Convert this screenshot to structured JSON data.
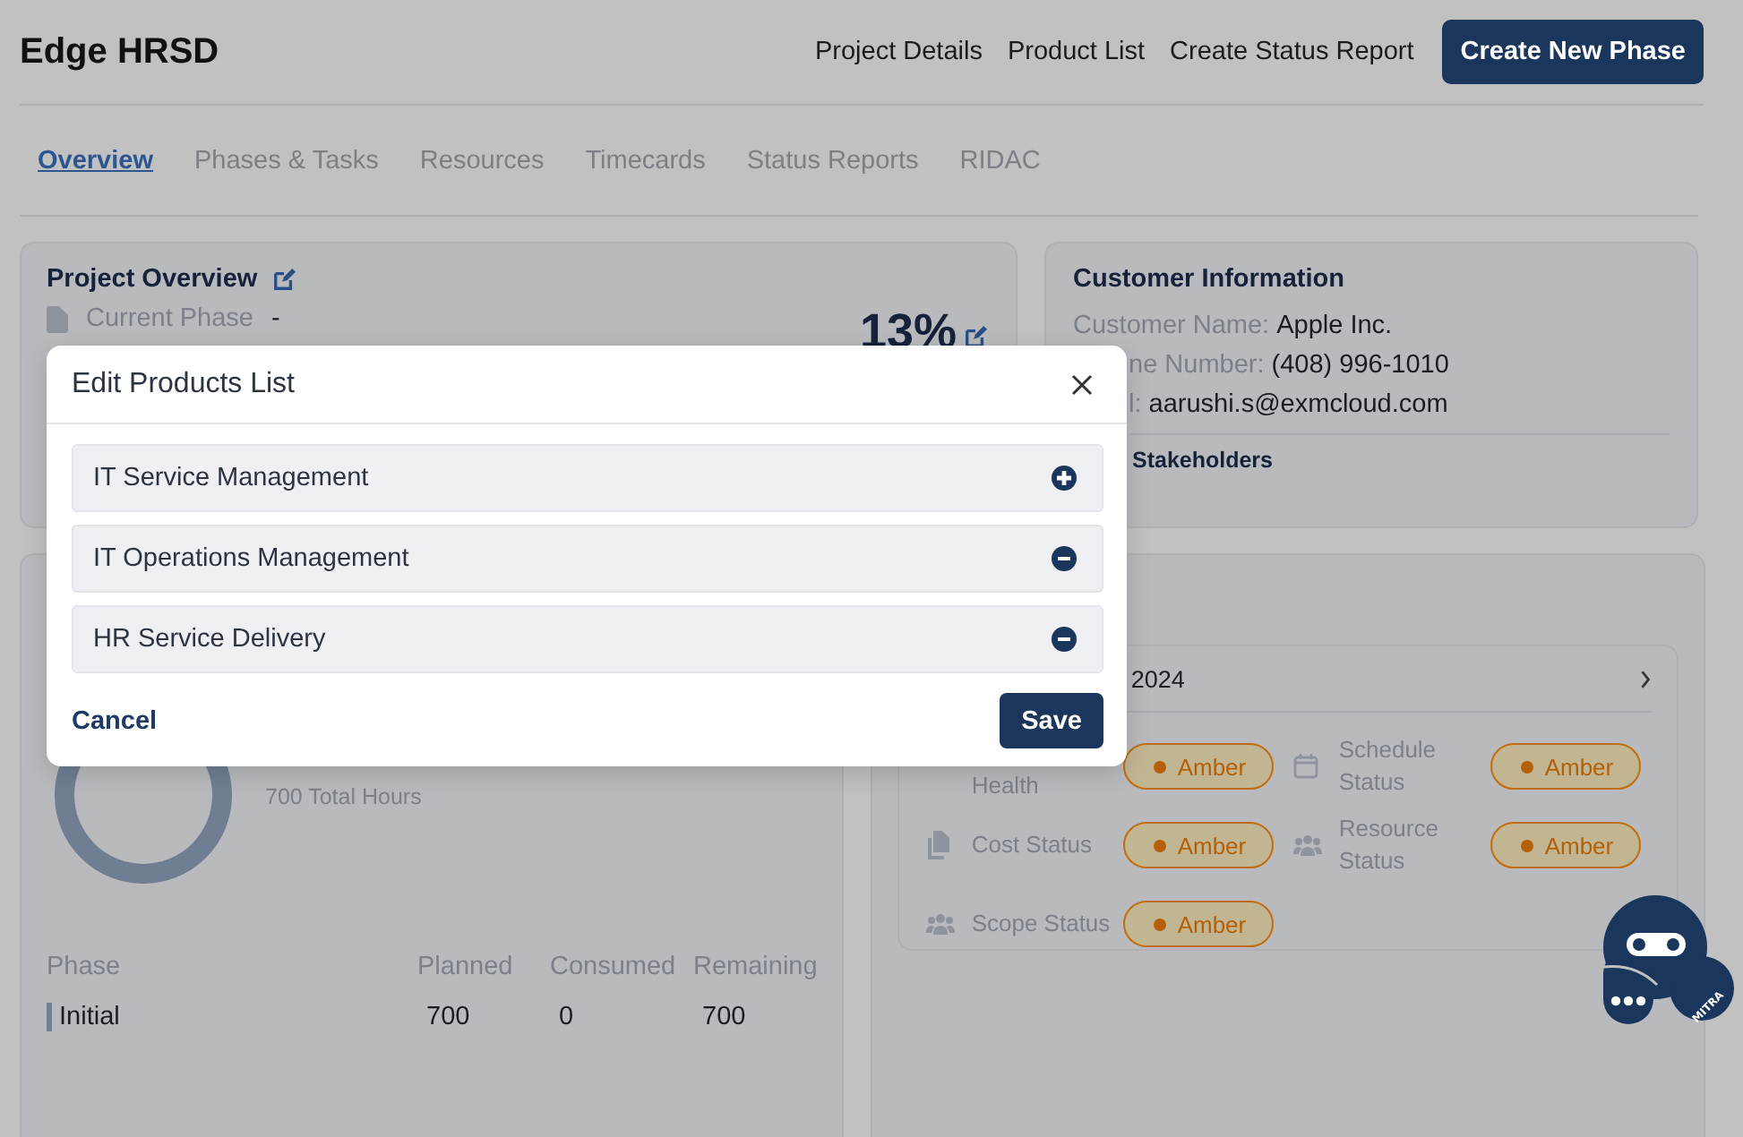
{
  "header": {
    "title": "Edge HRSD",
    "nav_links": [
      "Project Details",
      "Product List",
      "Create Status Report"
    ],
    "primary_button": "Create New Phase"
  },
  "tabs": [
    {
      "label": "Overview",
      "selected": true
    },
    {
      "label": "Phases & Tasks",
      "selected": false
    },
    {
      "label": "Resources",
      "selected": false
    },
    {
      "label": "Timecards",
      "selected": false
    },
    {
      "label": "Status Reports",
      "selected": false
    },
    {
      "label": "RIDAC",
      "selected": false
    }
  ],
  "project_overview": {
    "title": "Project Overview",
    "current_phase_label": "Current Phase",
    "current_phase_value": "-",
    "percent": "13%"
  },
  "customer_info": {
    "title": "Customer Information",
    "fields": [
      {
        "label": "Customer Name:",
        "value": "Apple Inc."
      },
      {
        "label": "ne Number:",
        "value": "(408) 996-1010"
      },
      {
        "label": "l:",
        "value": "aarushi.s@exmcloud.com"
      }
    ],
    "stakeholders": "Stakeholders"
  },
  "hours": {
    "total": "700 Total Hours",
    "columns": [
      "Phase",
      "Planned",
      "Consumed",
      "Remaining"
    ],
    "rows": [
      {
        "phase": "Initial",
        "planned": "700",
        "consumed": "0",
        "remaining": "700"
      }
    ]
  },
  "status": {
    "period": "2024",
    "items": [
      {
        "label": "Health",
        "status": "Amber"
      },
      {
        "label": "Schedule Status",
        "status": "Amber"
      },
      {
        "label": "Cost Status",
        "status": "Amber"
      },
      {
        "label": "Resource Status",
        "status": "Amber"
      },
      {
        "label": "Scope Status",
        "status": "Amber"
      }
    ]
  },
  "modal": {
    "title": "Edit Products List",
    "products": [
      {
        "name": "IT Service Management",
        "selected": false
      },
      {
        "name": "IT Operations Management",
        "selected": true
      },
      {
        "name": "HR Service Delivery",
        "selected": true
      }
    ],
    "cancel": "Cancel",
    "save": "Save"
  },
  "assistant": {
    "label": "MITRA"
  }
}
